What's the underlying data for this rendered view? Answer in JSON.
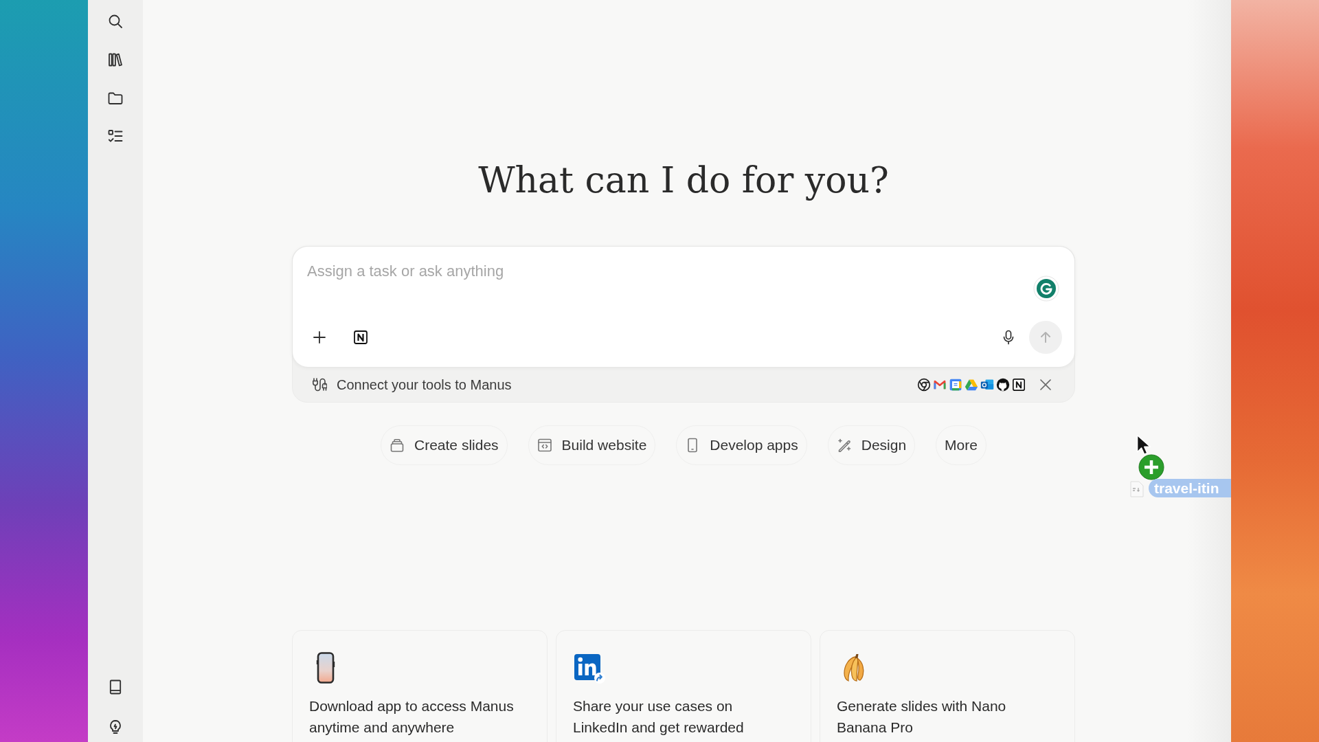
{
  "heading": "What can I do for you?",
  "composer": {
    "placeholder": "Assign a task or ask anything",
    "send_disabled": true
  },
  "connect_bar": {
    "label": "Connect your tools to Manus"
  },
  "quick_actions": [
    {
      "kind": "slides",
      "label": "Create slides"
    },
    {
      "kind": "website",
      "label": "Build website"
    },
    {
      "kind": "apps",
      "label": "Develop apps"
    },
    {
      "kind": "design",
      "label": "Design"
    },
    {
      "kind": "more",
      "label": "More"
    }
  ],
  "cards": [
    {
      "kind": "phone",
      "text": "Download app to access Manus anytime and anywhere"
    },
    {
      "kind": "linkedin",
      "text": "Share your use cases on LinkedIn and get rewarded"
    },
    {
      "kind": "banana",
      "text": "Generate slides with Nano Banana Pro"
    }
  ],
  "drag_preview": {
    "filename": "travel-itin"
  }
}
